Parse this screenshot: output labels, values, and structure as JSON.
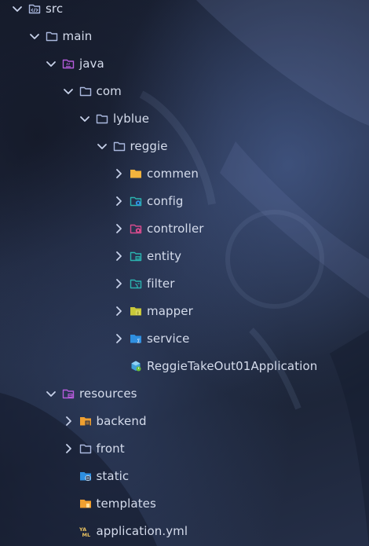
{
  "tree": {
    "items": [
      {
        "label": "src",
        "depth": 0,
        "expanded": true,
        "icon": "source-folder-icon"
      },
      {
        "label": "main",
        "depth": 1,
        "expanded": true,
        "icon": "folder-icon"
      },
      {
        "label": "java",
        "depth": 2,
        "expanded": true,
        "icon": "java-source-folder-icon"
      },
      {
        "label": "com",
        "depth": 3,
        "expanded": true,
        "icon": "package-folder-icon"
      },
      {
        "label": "lyblue",
        "depth": 4,
        "expanded": true,
        "icon": "package-folder-icon"
      },
      {
        "label": "reggie",
        "depth": 5,
        "expanded": true,
        "icon": "package-folder-icon"
      },
      {
        "label": "commen",
        "depth": 6,
        "expanded": false,
        "icon": "folder-yellow-icon"
      },
      {
        "label": "config",
        "depth": 6,
        "expanded": false,
        "icon": "config-folder-icon"
      },
      {
        "label": "controller",
        "depth": 6,
        "expanded": false,
        "icon": "controller-folder-icon"
      },
      {
        "label": "entity",
        "depth": 6,
        "expanded": false,
        "icon": "entity-folder-icon"
      },
      {
        "label": "filter",
        "depth": 6,
        "expanded": false,
        "icon": "filter-folder-icon"
      },
      {
        "label": "mapper",
        "depth": 6,
        "expanded": false,
        "icon": "mapper-folder-icon"
      },
      {
        "label": "service",
        "depth": 6,
        "expanded": false,
        "icon": "service-folder-icon"
      },
      {
        "label": "ReggieTakeOut01Application",
        "depth": 6,
        "expanded": null,
        "icon": "spring-boot-app-icon"
      },
      {
        "label": "resources",
        "depth": 2,
        "expanded": true,
        "icon": "resources-folder-icon"
      },
      {
        "label": "backend",
        "depth": 3,
        "expanded": false,
        "icon": "backend-folder-icon"
      },
      {
        "label": "front",
        "depth": 3,
        "expanded": false,
        "icon": "folder-icon"
      },
      {
        "label": "static",
        "depth": 3,
        "expanded": null,
        "icon": "static-folder-icon"
      },
      {
        "label": "templates",
        "depth": 3,
        "expanded": null,
        "icon": "templates-folder-icon"
      },
      {
        "label": "application.yml",
        "depth": 3,
        "expanded": null,
        "icon": "yaml-file-icon"
      }
    ]
  },
  "colors": {
    "text": "#d5dcec",
    "folder_outline": "#aab8de",
    "java_purple": "#b65cdc",
    "teal": "#2bb3b0",
    "yellow": "#f2b33d",
    "lime": "#c9c83a",
    "blue": "#2f8fe0",
    "orange": "#f0a030",
    "magenta": "#d64b8e"
  }
}
